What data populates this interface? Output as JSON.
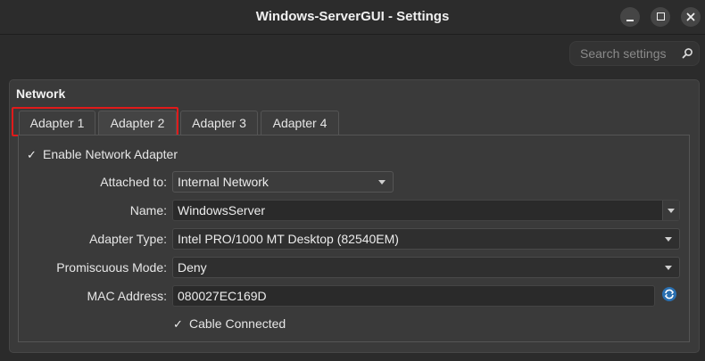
{
  "window": {
    "title": "Windows-ServerGUI - Settings",
    "controls": [
      "minimize-icon",
      "maximize-icon",
      "close-icon"
    ]
  },
  "search": {
    "placeholder": "Search settings",
    "icon": "search-icon"
  },
  "group": {
    "title": "Network"
  },
  "tabs": [
    {
      "label": "Adapter 1",
      "underlined_char": "1"
    },
    {
      "label": "Adapter 2",
      "underlined_char": "2",
      "active": true
    },
    {
      "label": "Adapter 3",
      "underlined_char": "3"
    },
    {
      "label": "Adapter 4",
      "underlined_char": "4"
    }
  ],
  "form": {
    "enable_label": "Enable Network Adapter",
    "enable_checked": true,
    "attached_label": "Attached to:",
    "attached_value": "Internal Network",
    "name_label": "Name:",
    "name_value": "WindowsServer",
    "adapter_type_label": "Adapter Type:",
    "adapter_type_value": "Intel PRO/1000 MT Desktop (82540EM)",
    "promiscuous_label": "Promiscuous Mode:",
    "promiscuous_value": "Deny",
    "mac_label": "MAC Address:",
    "mac_value": "080027EC169D",
    "cable_label": "Cable Connected",
    "cable_checked": true
  },
  "colors": {
    "background": "#2b2b2b",
    "panel": "#3a3a3a",
    "highlight_border": "#e01a1a",
    "refresh_accent": "#3a9ae8"
  }
}
